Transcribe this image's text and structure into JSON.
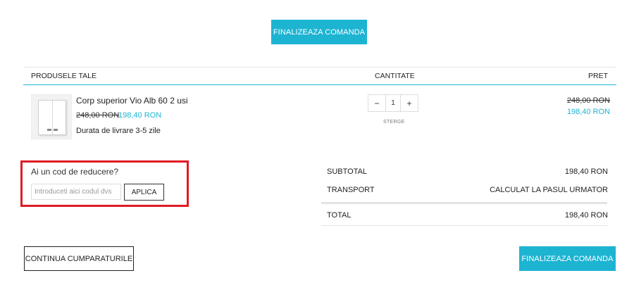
{
  "checkout_top_label": "FINALIZEAZA COMANDA",
  "table": {
    "headers": {
      "product": "PRODUSELE TALE",
      "quantity": "CANTITATE",
      "price": "PRET"
    }
  },
  "item": {
    "name": "Corp superior Vio Alb 60 2 usi",
    "old_price": "248,00 RON",
    "new_price": "198,40 RON",
    "delivery": "Durata de livrare 3-5 zile",
    "quantity": "1",
    "remove_label": "STERGE",
    "line_old_price": "248,00 RON",
    "line_new_price": "198,40 RON"
  },
  "promo": {
    "question": "Ai un cod de reducere?",
    "placeholder": "Introduceti aici codul dvs",
    "apply_label": "APLICA"
  },
  "summary": {
    "subtotal_label": "SUBTOTAL",
    "subtotal_value": "198,40 RON",
    "shipping_label": "TRANSPORT",
    "shipping_value": "CALCULAT LA PASUL URMATOR",
    "total_label": "TOTAL",
    "total_value": "198,40 RON"
  },
  "continue_label": "CONTINUA CUMPARATURILE",
  "checkout_bottom_label": "FINALIZEAZA COMANDA",
  "colors": {
    "accent": "#1db4d2",
    "highlight": "#e01b24"
  }
}
